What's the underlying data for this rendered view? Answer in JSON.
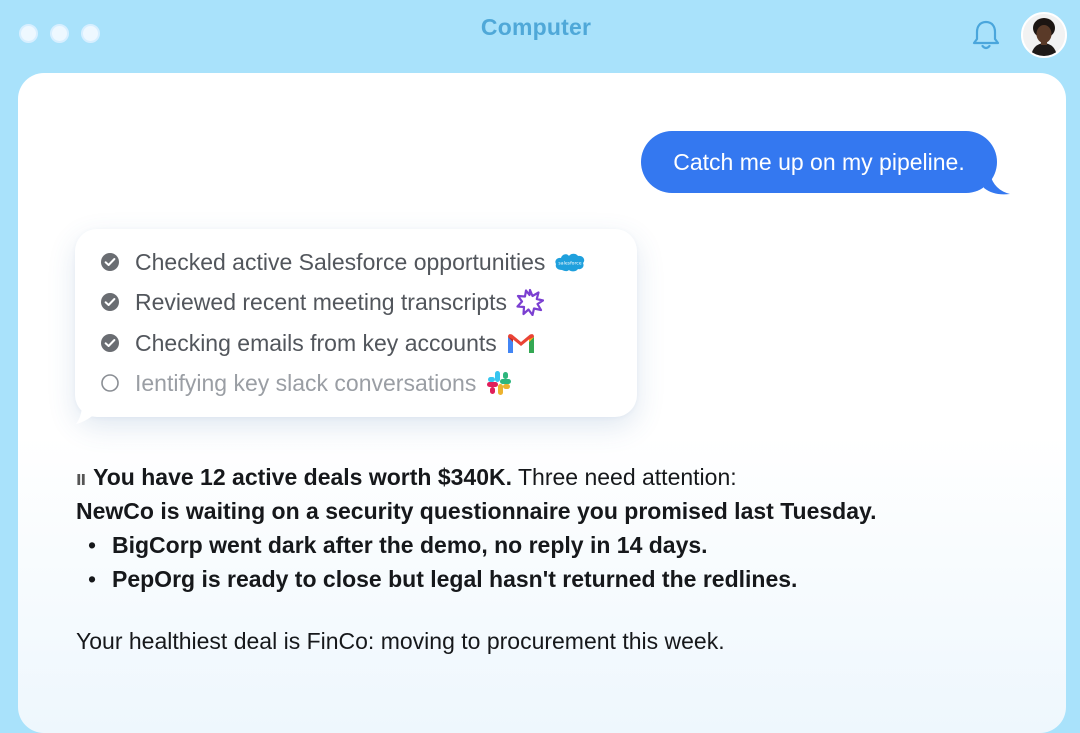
{
  "window": {
    "title": "Computer",
    "avatar_alt": "User avatar"
  },
  "colors": {
    "background": "#a9e2fb",
    "title": "#4fa8d8",
    "user_bubble": "#3478f0",
    "done_check": "#6a6d72",
    "pending_text": "#9a9ea4"
  },
  "chat": {
    "user_message": "Catch me up on my pipeline.",
    "tasks": [
      {
        "label": "Checked active Salesforce opportunities",
        "status": "done",
        "icon": "salesforce-icon"
      },
      {
        "label": "Reviewed recent meeting transcripts",
        "status": "done",
        "icon": "sparkle-burst-icon"
      },
      {
        "label": "Checking emails from key accounts",
        "status": "done",
        "icon": "gmail-icon"
      },
      {
        "label": "Ientifying key slack conversations",
        "status": "pending",
        "icon": "slack-icon"
      }
    ],
    "reply": {
      "summary_bold": "You have 12 active deals worth $340K.",
      "summary_rest": " Three need attention:",
      "line2": "NewCo is waiting on a security questionnaire you promised last Tuesday.",
      "bullets": [
        "BigCorp went dark after the demo, no reply in 14 days.",
        "PepOrg is ready to close but legal hasn't returned the redlines."
      ],
      "healthiest": "Your healthiest deal is FinCo: moving to procurement this week."
    },
    "salesforce_logo_text": "salesforce"
  }
}
